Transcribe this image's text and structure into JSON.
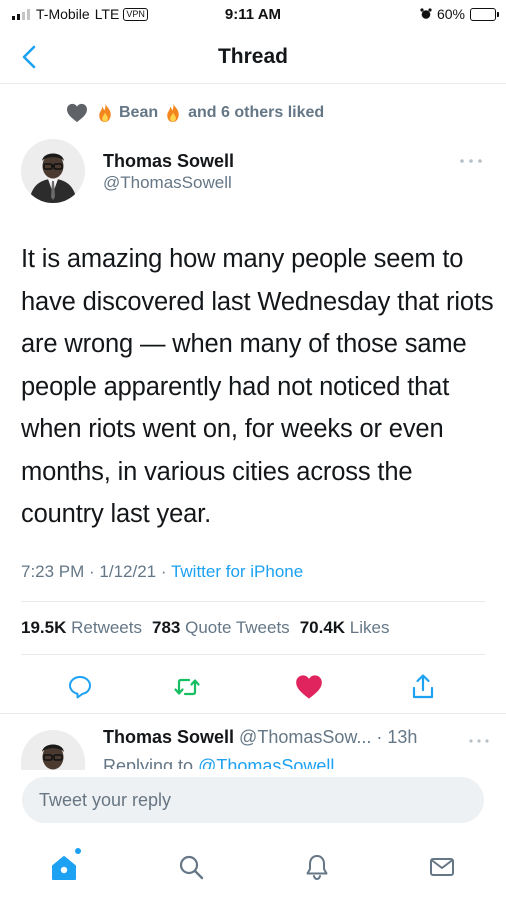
{
  "status_bar": {
    "carrier": "T-Mobile",
    "network": "LTE",
    "vpn": "VPN",
    "time": "9:11 AM",
    "battery_percent": "60%",
    "battery_level": 0.6
  },
  "header": {
    "title": "Thread"
  },
  "social_context": {
    "liker": "Bean",
    "others": "and 6 others liked"
  },
  "tweet": {
    "author_name": "Thomas Sowell",
    "author_handle": "@ThomasSowell",
    "text": "It is amazing how many people seem to have discovered last Wednesday that riots are wrong — when many of those same people apparently had not noticed that when riots went on, for weeks or even months, in various cities across the country last year.",
    "timestamp": "7:23 PM · 1/12/21 · ",
    "source": "Twitter for iPhone",
    "stats": {
      "retweets_count": "19.5K",
      "retweets_label": "Retweets",
      "quotes_count": "783",
      "quotes_label": "Quote Tweets",
      "likes_count": "70.4K",
      "likes_label": "Likes"
    }
  },
  "reply_preview": {
    "author_name": "Thomas Sowell",
    "author_handle": "@ThomasSow...",
    "age": "· 13h",
    "replying_to_label": "Replying to",
    "replying_to_handle": "@ThomasSowell"
  },
  "composer": {
    "placeholder": "Tweet your reply"
  },
  "colors": {
    "accent": "#1da1f2",
    "like": "#e0245e",
    "retweet": "#17bf63",
    "secondary_text": "#657786"
  }
}
